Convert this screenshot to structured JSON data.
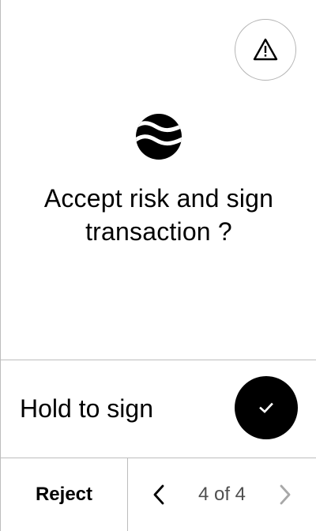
{
  "header": {
    "warning_icon": "warning-triangle-icon"
  },
  "main": {
    "logo_icon": "waves-logo-icon",
    "title": "Accept risk and sign transaction ?"
  },
  "hold": {
    "label": "Hold to sign",
    "button_icon": "checkmark-icon"
  },
  "footer": {
    "reject_label": "Reject",
    "pager": {
      "text": "4 of 4",
      "current": 4,
      "total": 4,
      "prev_icon": "chevron-left-icon",
      "next_icon": "chevron-right-icon"
    }
  },
  "colors": {
    "background": "#ffffff",
    "foreground": "#000000",
    "divider": "#bdbdbd",
    "muted_text": "#4f4f4f",
    "disabled_icon": "#a8a8a8"
  }
}
